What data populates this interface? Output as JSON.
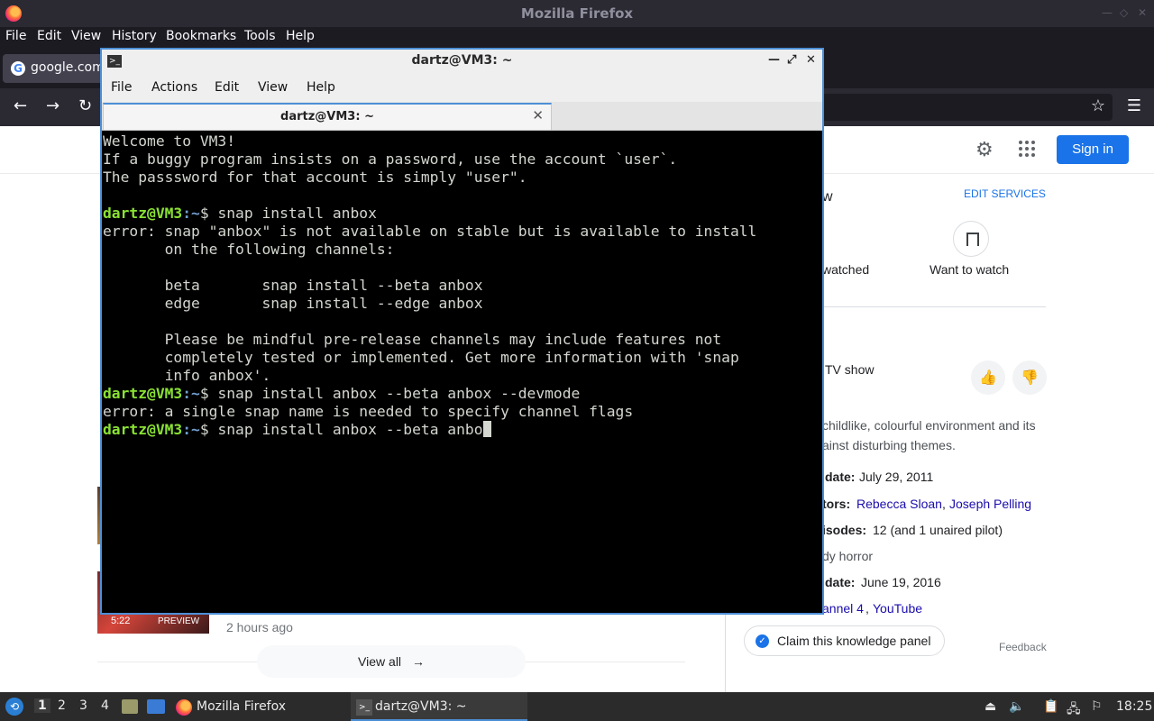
{
  "firefox": {
    "window_title": "Mozilla Firefox",
    "menu": [
      "File",
      "Edit",
      "View",
      "History",
      "Bookmarks",
      "Tools",
      "Help"
    ],
    "tab_title": "google.com",
    "icons": [
      "back-icon",
      "forward-icon",
      "reload-icon",
      "bookmark-star-icon",
      "hamburger-menu-icon"
    ]
  },
  "google_page": {
    "sign_in": "Sign in",
    "edit_services": "EDIT SERVICES",
    "want_to_watch": "Want to watch",
    "watched_fragment": "watched",
    "w_fragment": "w",
    "type_fragment": "TV show",
    "description_line1": "childlike, colourful environment and its",
    "description_line2": "ainst disturbing themes.",
    "first_date_label": "date:",
    "first_date_value": "July 29, 2011",
    "creators_label": "tors:",
    "creator1": "Rebecca Sloan",
    "creator2": "Joseph Pelling",
    "episodes_label": "isodes:",
    "episodes_value": "12 (and 1 unaired pilot)",
    "genre_fragment": "dy horror",
    "final_date_label": "date:",
    "final_date_value": "June 19, 2016",
    "network1": "annel 4",
    "network2": "YouTube",
    "claim_panel": "Claim this knowledge panel",
    "feedback": "Feedback",
    "video_duration": "5:22",
    "video_preview": "PREVIEW",
    "video_age": "2 hours ago",
    "view_all": "View all"
  },
  "terminal": {
    "window_title": "dartz@VM3: ~",
    "menu": [
      "File",
      "Actions",
      "Edit",
      "View",
      "Help"
    ],
    "tab_title": "dartz@VM3: ~",
    "prompt_user": "dartz@VM3",
    "prompt_path": ":~",
    "lines": [
      {
        "type": "text",
        "text": "Welcome to VM3!"
      },
      {
        "type": "text",
        "text": "If a buggy program insists on a password, use the account `user`."
      },
      {
        "type": "text",
        "text": "The passsword for that account is simply \"user\"."
      },
      {
        "type": "text",
        "text": ""
      },
      {
        "type": "prompt",
        "cmd": "$ snap install anbox"
      },
      {
        "type": "text",
        "text": "error: snap \"anbox\" is not available on stable but is available to install"
      },
      {
        "type": "text",
        "text": "       on the following channels:"
      },
      {
        "type": "text",
        "text": ""
      },
      {
        "type": "text",
        "text": "       beta       snap install --beta anbox"
      },
      {
        "type": "text",
        "text": "       edge       snap install --edge anbox"
      },
      {
        "type": "text",
        "text": ""
      },
      {
        "type": "text",
        "text": "       Please be mindful pre-release channels may include features not"
      },
      {
        "type": "text",
        "text": "       completely tested or implemented. Get more information with 'snap"
      },
      {
        "type": "text",
        "text": "       info anbox'."
      },
      {
        "type": "prompt",
        "cmd": "$ snap install anbox --beta anbox --devmode"
      },
      {
        "type": "text",
        "text": "error: a single snap name is needed to specify channel flags"
      },
      {
        "type": "prompt",
        "cmd": "$ snap install anbox --beta anbo",
        "cursor": true
      }
    ]
  },
  "taskbar": {
    "workspaces": [
      "1",
      "2",
      "3",
      "4"
    ],
    "task_firefox": "Mozilla Firefox",
    "task_terminal": "dartz@VM3: ~",
    "clock": "18:25"
  },
  "colors": {
    "prompt_user": "#8ae234",
    "prompt_path": "#729fcf",
    "accent": "#4d8fd6",
    "google_blue": "#1a73e8"
  }
}
